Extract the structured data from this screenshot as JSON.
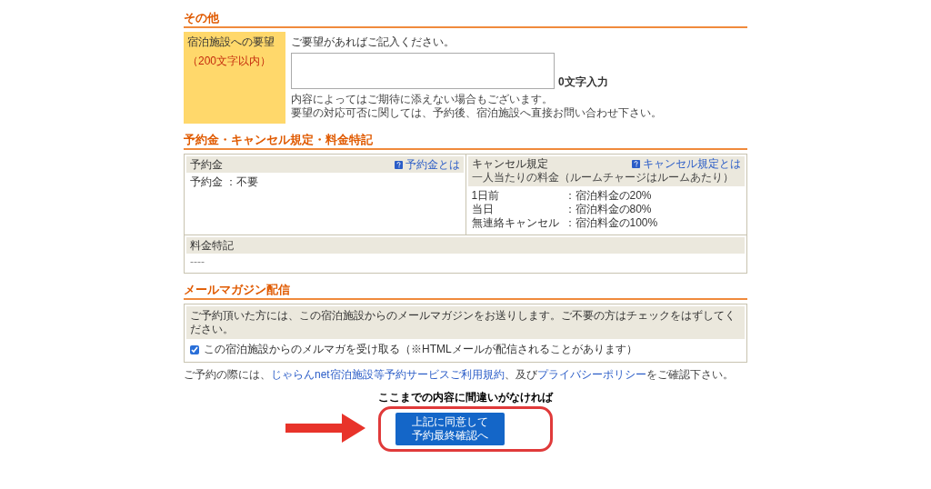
{
  "other": {
    "heading": "その他",
    "label": "宿泊施設への要望",
    "limit": "（200文字以内）",
    "prompt": "ご要望があればご記入ください。",
    "count": "0文字入力",
    "notes": [
      "内容によってはご期待に添えない場合もございます。",
      "要望の対応可否に関しては、予約後、宿泊施設へ直接お問い合わせ下さい。"
    ]
  },
  "policy": {
    "heading": "予約金・キャンセル規定・料金特記",
    "deposit": {
      "title": "予約金",
      "link": "予約金とは",
      "value": "予約金 ：不要"
    },
    "cancel": {
      "title": "キャンセル規定",
      "link": "キャンセル規定とは",
      "subtitle": "一人当たりの料金（ルームチャージはルームあたり）",
      "rows": [
        {
          "when": "1日前",
          "fee": "：宿泊料金の20%"
        },
        {
          "when": "当日",
          "fee": "：宿泊料金の80%"
        },
        {
          "when": "無連絡キャンセル",
          "fee": "：宿泊料金の100%"
        }
      ]
    },
    "remarks": {
      "title": "料金特記",
      "value": "----"
    }
  },
  "newsletter": {
    "heading": "メールマガジン配信",
    "message": "ご予約頂いた方には、この宿泊施設からのメールマガジンをお送りします。ご不要の方はチェックをはずしてください。",
    "checkbox": {
      "label": "この宿泊施設からのメルマガを受け取る（※HTMLメールが配信されることがあります）",
      "checked": true
    }
  },
  "terms": {
    "before": "ご予約の際には、",
    "link1": "じゃらんnet宿泊施設等予約サービスご利用規約",
    "middle": "、及び",
    "link2": "プライバシーポリシー",
    "after": "をご確認下さい。"
  },
  "confirm": {
    "caption": "ここまでの内容に間違いがなければ",
    "button": [
      "上記に同意して",
      "予約最終確認へ"
    ]
  }
}
